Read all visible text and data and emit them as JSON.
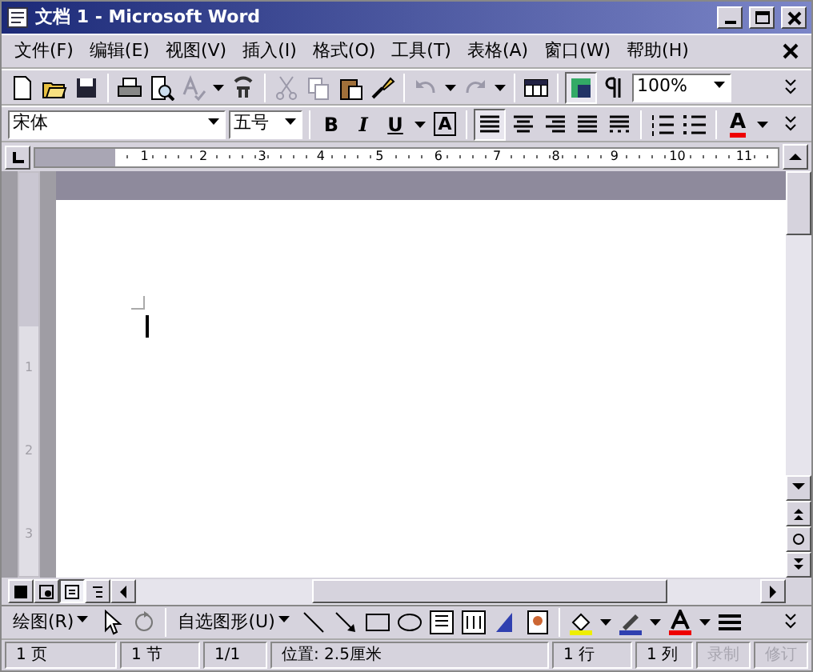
{
  "window": {
    "title": "文档 1 - Microsoft Word"
  },
  "menu": [
    {
      "label": "文件(F)"
    },
    {
      "label": "编辑(E)"
    },
    {
      "label": "视图(V)"
    },
    {
      "label": "插入(I)"
    },
    {
      "label": "格式(O)"
    },
    {
      "label": "工具(T)"
    },
    {
      "label": "表格(A)"
    },
    {
      "label": "窗口(W)"
    },
    {
      "label": "帮助(H)"
    }
  ],
  "standard_toolbar": {
    "zoom": "100%"
  },
  "formatting_toolbar": {
    "font": "宋体",
    "size": "五号",
    "bold": "B",
    "italic": "I",
    "underline": "U",
    "char_border": "A",
    "font_color": "A"
  },
  "ruler": {
    "labels": [
      "1",
      "2",
      "3",
      "4",
      "5",
      "6",
      "7",
      "8",
      "9",
      "10",
      "11"
    ]
  },
  "vertical_ruler": {
    "labels": [
      "1",
      "2",
      "3"
    ]
  },
  "view_buttons": [
    {
      "selected": false
    },
    {
      "selected": false
    },
    {
      "selected": true
    },
    {
      "selected": false
    }
  ],
  "drawing_toolbar": {
    "draw_menu": "绘图(R)",
    "autoshapes": "自选图形(U)"
  },
  "status_bar": [
    {
      "text": "1 页",
      "disabled": false
    },
    {
      "text": "1 节",
      "disabled": false
    },
    {
      "text": "1/1",
      "disabled": false
    },
    {
      "text": "位置: 2.5厘米",
      "disabled": false
    },
    {
      "text": "1 行",
      "disabled": false
    },
    {
      "text": "1 列",
      "disabled": false
    },
    {
      "text": "录制",
      "disabled": true
    },
    {
      "text": "修订",
      "disabled": true
    }
  ]
}
